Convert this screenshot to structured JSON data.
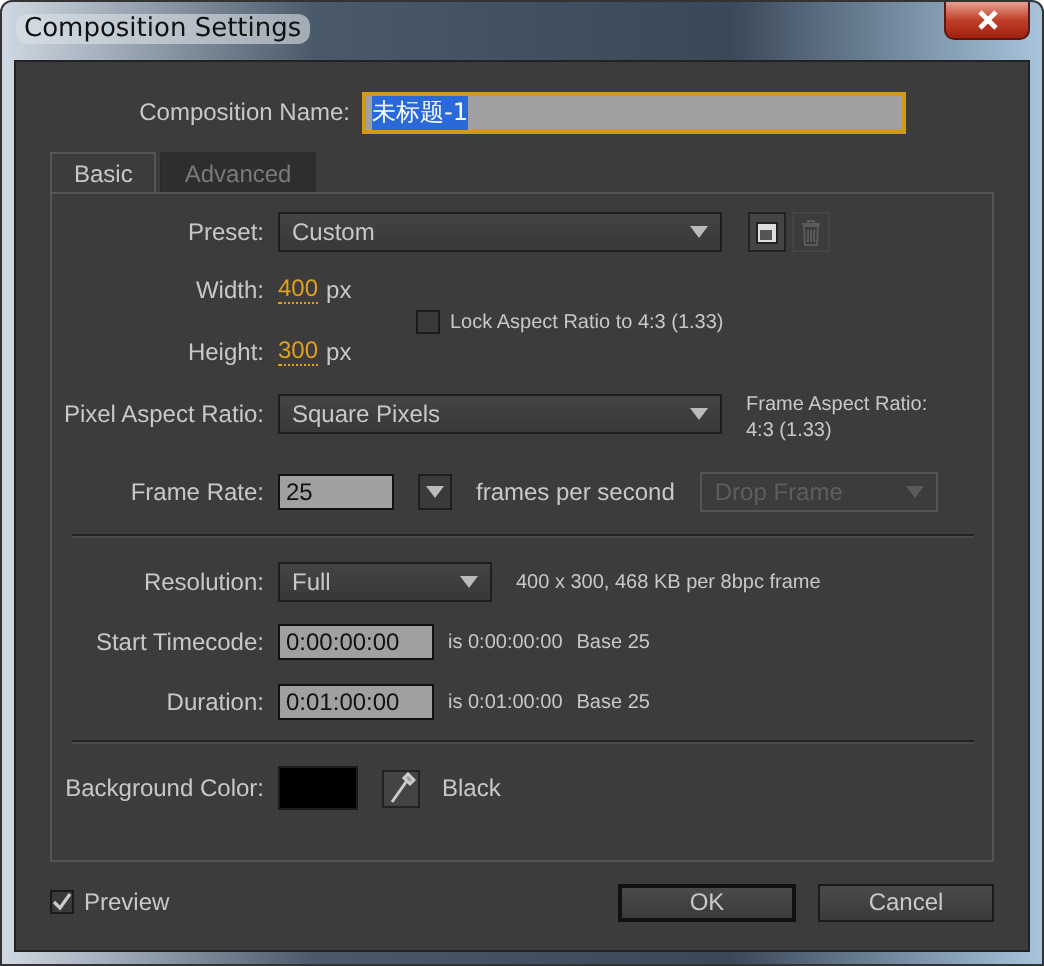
{
  "window": {
    "title": "Composition Settings"
  },
  "composition_name": {
    "label": "Composition Name:",
    "value": "未标题-1",
    "selected": true
  },
  "tabs": [
    {
      "label": "Basic",
      "selected": true
    },
    {
      "label": "Advanced",
      "selected": false
    }
  ],
  "preset": {
    "label": "Preset:",
    "value": "Custom"
  },
  "width": {
    "label": "Width:",
    "value": "400",
    "unit": "px"
  },
  "lock_aspect": {
    "label": "Lock Aspect Ratio to 4:3 (1.33)",
    "checked": false
  },
  "height": {
    "label": "Height:",
    "value": "300",
    "unit": "px"
  },
  "pixel_aspect": {
    "label": "Pixel Aspect Ratio:",
    "value": "Square Pixels"
  },
  "frame_aspect": {
    "label": "Frame Aspect Ratio:",
    "value": "4:3 (1.33)"
  },
  "frame_rate": {
    "label": "Frame Rate:",
    "value": "25",
    "unit": "frames per second"
  },
  "drop_frame": {
    "value": "Drop Frame",
    "disabled": true
  },
  "resolution": {
    "label": "Resolution:",
    "value": "Full",
    "info": "400 x 300, 468 KB per 8bpc frame"
  },
  "timecodes": [
    {
      "label": "Start Timecode:",
      "value": "0:00:00:00",
      "info": "is 0:00:00:00",
      "base": "Base 25"
    },
    {
      "label": "Duration:",
      "value": "0:01:00:00",
      "info": "is 0:01:00:00",
      "base": "Base 25"
    }
  ],
  "background": {
    "label": "Background Color:",
    "color": "#000000",
    "name": "Black"
  },
  "preview": {
    "label": "Preview",
    "checked": true
  },
  "buttons": [
    {
      "label": "OK",
      "kind": "default"
    },
    {
      "label": "Cancel",
      "kind": "normal"
    }
  ]
}
